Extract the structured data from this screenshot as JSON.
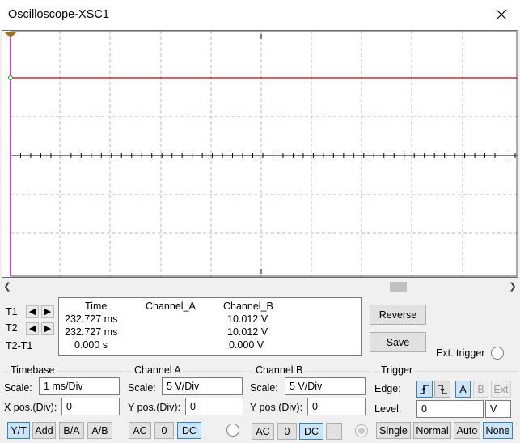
{
  "window": {
    "title": "Oscilloscope-XSC1",
    "close_icon": "close-icon"
  },
  "cursors": {
    "t1": "T1",
    "t2": "T2",
    "t2_t1": "T2-T1"
  },
  "readout": {
    "headers": [
      "Time",
      "Channel_A",
      "Channel_B"
    ],
    "rows": [
      {
        "time": "232.727 ms",
        "a": "",
        "b": "10.012 V"
      },
      {
        "time": "232.727 ms",
        "a": "",
        "b": "10.012 V"
      },
      {
        "time": "0.000 s",
        "a": "",
        "b": "0.000 V"
      }
    ]
  },
  "actions": {
    "reverse": "Reverse",
    "save": "Save",
    "ext_trigger": "Ext. trigger"
  },
  "timebase": {
    "title": "Timebase",
    "scale_label": "Scale:",
    "scale_value": "1 ms/Div",
    "xpos_label": "X pos.(Div):",
    "xpos_value": "0",
    "modes": [
      "Y/T",
      "Add",
      "B/A",
      "A/B"
    ],
    "active_mode": "Y/T"
  },
  "channel_a": {
    "title": "Channel A",
    "scale_label": "Scale:",
    "scale_value": "5  V/Div",
    "ypos_label": "Y pos.(Div):",
    "ypos_value": "0",
    "coupling": [
      "AC",
      "0",
      "DC"
    ],
    "active_coupling": "DC"
  },
  "channel_b": {
    "title": "Channel B",
    "scale_label": "Scale:",
    "scale_value": "5  V/Div",
    "ypos_label": "Y pos.(Div):",
    "ypos_value": "0",
    "coupling": [
      "AC",
      "0",
      "DC",
      "-"
    ],
    "active_coupling": "DC"
  },
  "trigger": {
    "title": "Trigger",
    "edge_label": "Edge:",
    "level_label": "Level:",
    "level_value": "0",
    "level_unit": "V",
    "sources": [
      "A",
      "B",
      "Ext"
    ],
    "active_source": "A",
    "modes": [
      "Single",
      "Normal",
      "Auto",
      "None"
    ],
    "active_mode": "None"
  },
  "colors": {
    "trace_b": "#c00000",
    "trace_a": "#c000c0",
    "accent": "#3c7fb1",
    "grid": "#b8b8b8"
  }
}
